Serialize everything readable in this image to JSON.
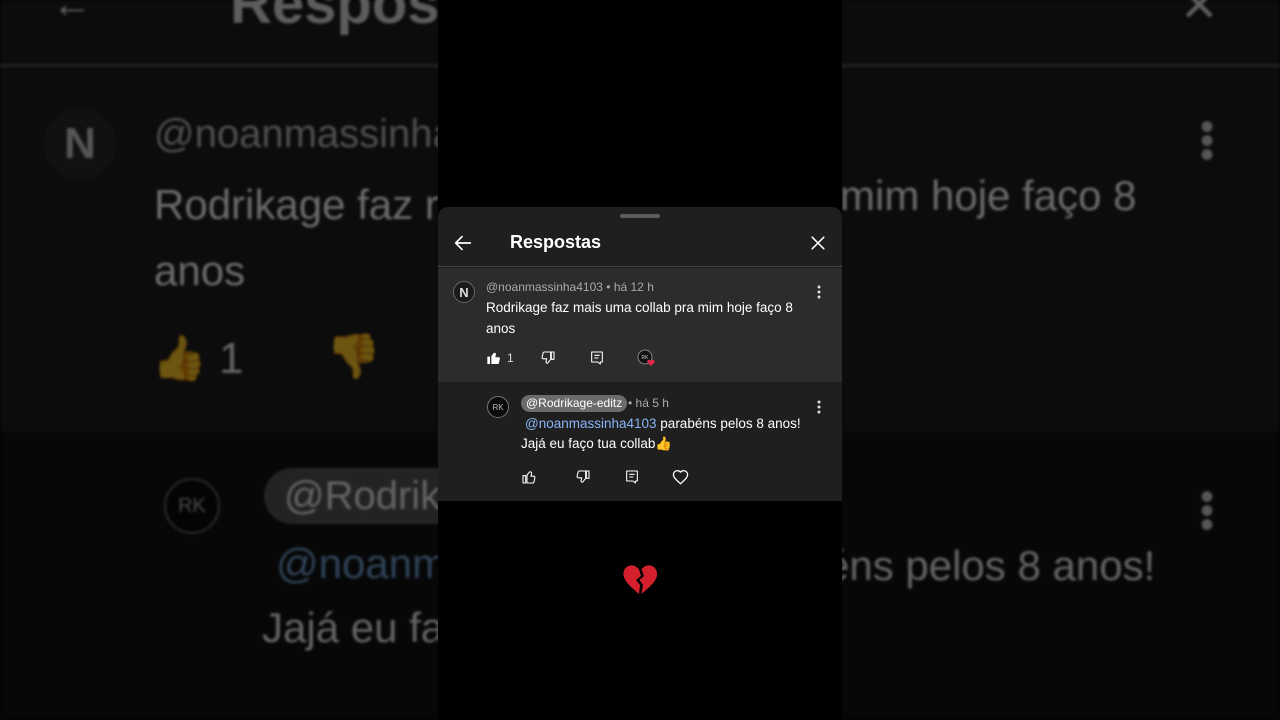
{
  "app": {
    "panel_title": "Respostas"
  },
  "comment": {
    "avatar_letter": "N",
    "author": "@noanmassinha4103",
    "separator": "•",
    "time": "há 12 h",
    "text": "Rodrikage faz mais uma collab pra mim hoje faço 8 anos",
    "like_count": "1"
  },
  "reply": {
    "avatar_letters": "RK",
    "author": "@Rodrikage-editz",
    "separator": "•",
    "time": "há 5 h",
    "mention": "@noanmassinha4103",
    "text_line1": " parabéns pelos 8 anos!",
    "text_line2": "Jajá eu faço tua collab👍"
  },
  "colors": {
    "accent_link": "#8ab4f8",
    "heart": "#e0284a",
    "sheet_bg": "#1f1f1f",
    "highlight_bg": "#2c2c2c"
  },
  "icons": [
    "back-arrow-icon",
    "close-icon",
    "thumbs-up-icon",
    "thumbs-down-icon",
    "reply-icon",
    "heart-icon",
    "more-vert-icon",
    "broken-heart-icon"
  ]
}
